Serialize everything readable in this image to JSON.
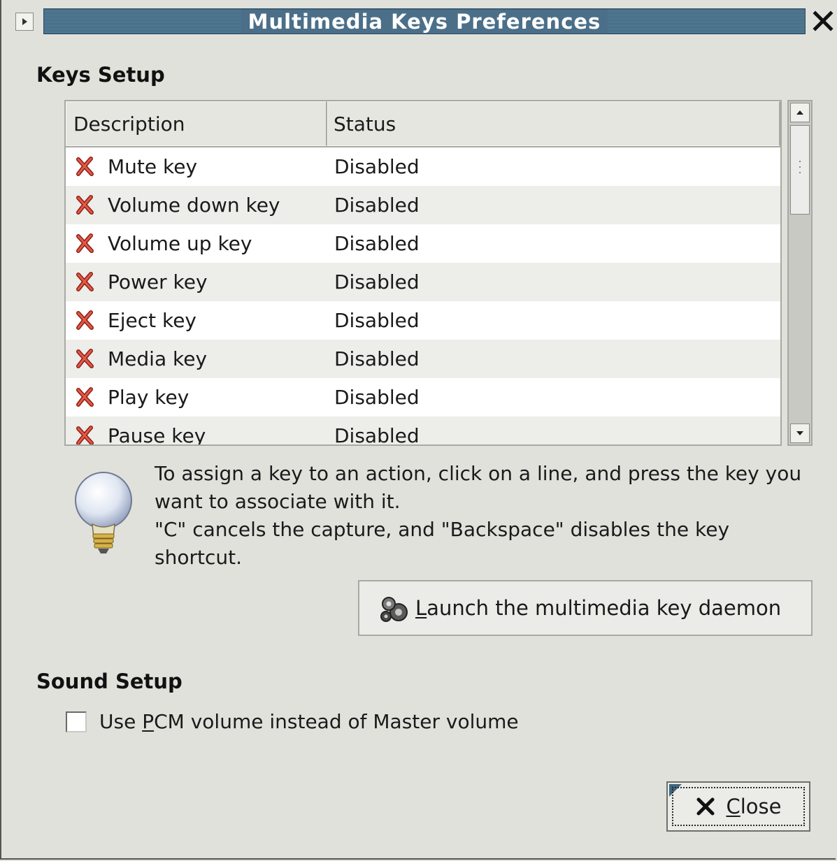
{
  "window": {
    "title": "Multimedia Keys Preferences"
  },
  "keys_setup": {
    "heading": "Keys Setup",
    "columns": [
      "Description",
      "Status"
    ],
    "rows": [
      {
        "icon": "disabled-x-icon",
        "description": "Mute key",
        "status": "Disabled"
      },
      {
        "icon": "disabled-x-icon",
        "description": "Volume down key",
        "status": "Disabled"
      },
      {
        "icon": "disabled-x-icon",
        "description": "Volume up key",
        "status": "Disabled"
      },
      {
        "icon": "disabled-x-icon",
        "description": "Power key",
        "status": "Disabled"
      },
      {
        "icon": "disabled-x-icon",
        "description": "Eject key",
        "status": "Disabled"
      },
      {
        "icon": "disabled-x-icon",
        "description": "Media key",
        "status": "Disabled"
      },
      {
        "icon": "disabled-x-icon",
        "description": "Play key",
        "status": "Disabled"
      },
      {
        "icon": "disabled-x-icon",
        "description": "Pause key",
        "status": "Disabled"
      }
    ],
    "info_line1": "To assign a key to an action, click on a line, and press the key you want to associate with it.",
    "info_line2": "\"C\" cancels the capture, and \"Backspace\" disables the key shortcut.",
    "launch_button": {
      "mnemonic": "L",
      "label_rest": "aunch the multimedia key daemon",
      "icon": "gears-icon"
    }
  },
  "sound_setup": {
    "heading": "Sound Setup",
    "checkbox": {
      "checked": false,
      "label_before": "Use ",
      "mnemonic": "P",
      "label_after": "CM volume instead of Master volume"
    }
  },
  "close_button": {
    "mnemonic": "C",
    "label_rest": "lose",
    "icon": "close-x-icon"
  },
  "colors": {
    "window_bg": "#e1e1dc",
    "titlebar": "#4b6f88",
    "disabled_icon": "#c0392b"
  }
}
